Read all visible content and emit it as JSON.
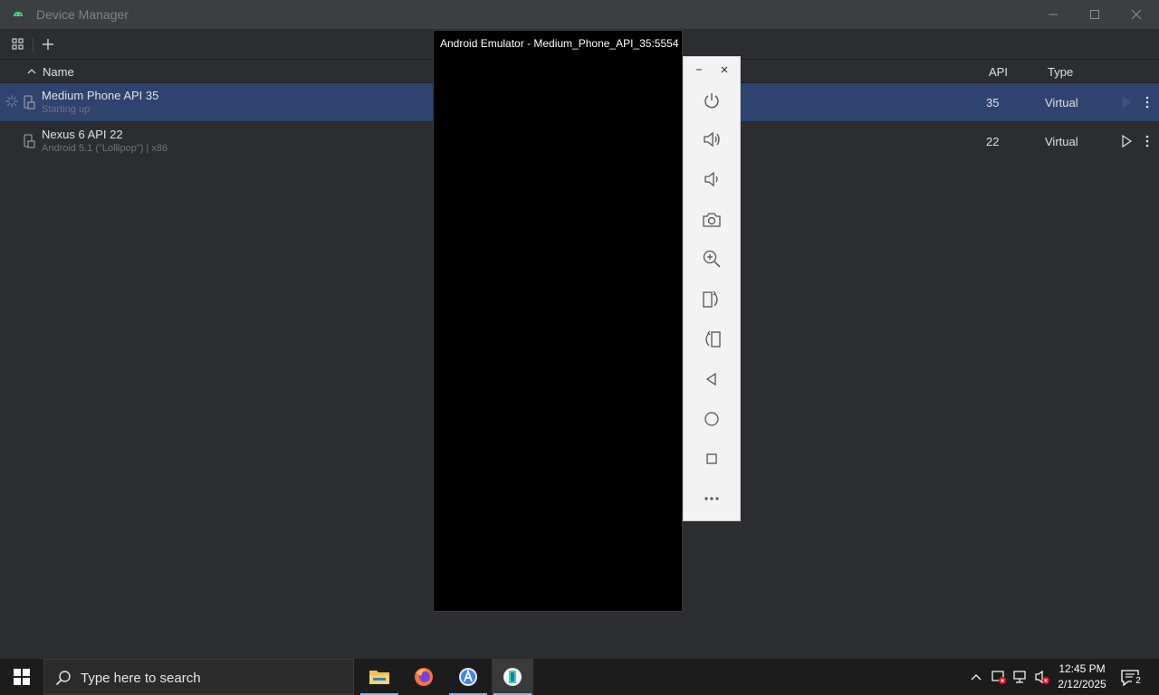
{
  "window": {
    "title": "Device Manager"
  },
  "table": {
    "columns": {
      "name": "Name",
      "api": "API",
      "type": "Type"
    },
    "rows": [
      {
        "name": "Medium Phone API 35",
        "subtitle": "Starting up",
        "api": "35",
        "type": "Virtual",
        "selected": true
      },
      {
        "name": "Nexus 6 API 22",
        "subtitle": "Android 5.1 (\"Lollipop\") | x86",
        "api": "22",
        "type": "Virtual",
        "selected": false
      }
    ]
  },
  "emulator": {
    "title": "Android Emulator - Medium_Phone_API_35:5554",
    "side_buttons": [
      "power-icon",
      "volume-up-icon",
      "volume-down-icon",
      "camera-icon",
      "zoom-icon",
      "rotate-left-icon",
      "rotate-right-icon",
      "back-icon",
      "home-icon",
      "overview-icon",
      "more-icon"
    ]
  },
  "taskbar": {
    "search_placeholder": "Type here to search",
    "time": "12:45 PM",
    "date": "2/12/2025",
    "notification_count": "2",
    "apps": [
      "file-explorer-icon",
      "firefox-icon",
      "android-studio-icon",
      "device-manager-icon"
    ]
  },
  "colors": {
    "selection": "#2e436e",
    "window_bg": "#2b2d30",
    "accent": "#76b9ed"
  }
}
